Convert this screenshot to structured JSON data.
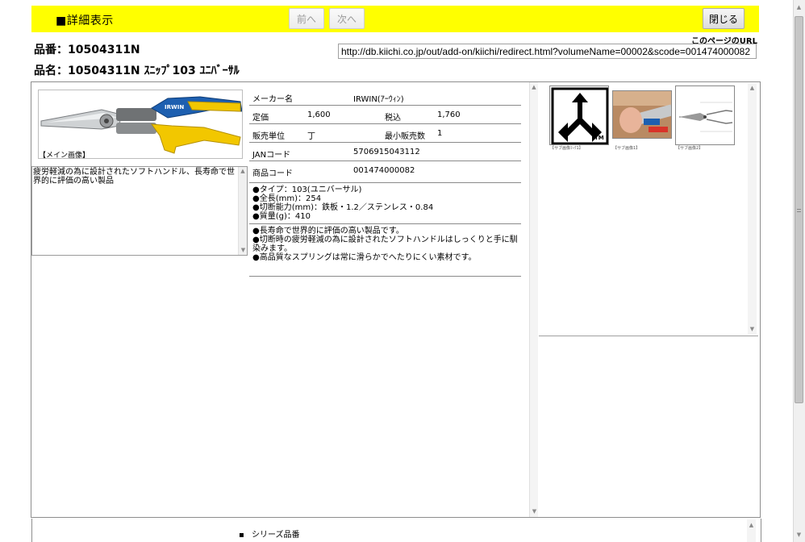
{
  "header": {
    "title": "■詳細表示",
    "prev_label": "前へ",
    "next_label": "次へ",
    "close_label": "閉じる"
  },
  "product": {
    "number_line": "品番：10504311N",
    "name_line": "品名：10504311N ｽﾆｯﾌﾟ103 ﾕﾆﾊﾞｰｻﾙ"
  },
  "page_url": {
    "caption": "このページのURL",
    "value": "http://db.kiichi.co.jp/out/add-on/kiichi/redirect.html?volumeName=00002&scode=001474000082"
  },
  "main_image": {
    "caption": "【メイン画像】"
  },
  "description": "疲労軽減の為に設計されたソフトハンドル、長寿命で世界的に評価の高い製品",
  "specs": {
    "maker_label": "メーカー名",
    "maker_value": "IRWIN(ｱｰｳｨﾝ)",
    "price_label": "定価",
    "price_value": "1,600",
    "tax_label": "税込",
    "tax_value": "1,760",
    "unit_label": "販売単位",
    "unit_value": "丁",
    "min_label": "最小販売数",
    "min_value": "1",
    "jan_label": "JANコード",
    "jan_value": "5706915043112",
    "code_label": "商品コード",
    "code_value": "001474000082"
  },
  "specs_list": [
    "●タイプ：103(ユニバーサル)",
    "●全長(mm)：254",
    "●切断能力(mm)：鉄板・1.2／ステンレス・0.84",
    "●質量(g)：410"
  ],
  "features": [
    "●長寿命で世界的に評価の高い製品です。",
    "●切断時の疲労軽減の為に設計されたソフトハンドルはしっくりと手に馴染みます。",
    "●高品質なスプリングは常に滑らかでへたりにくい素材です。"
  ],
  "sub_images": [
    {
      "caption": "【サブ画像ﾏｰｸ1】"
    },
    {
      "caption": "【サブ画像1】"
    },
    {
      "caption": "【サブ画像2】"
    }
  ],
  "series": {
    "label": "シリーズ品番"
  },
  "colors": {
    "header_bg": "#ffff00",
    "irwin_yellow": "#f2c700",
    "irwin_blue": "#1d5fb0"
  }
}
